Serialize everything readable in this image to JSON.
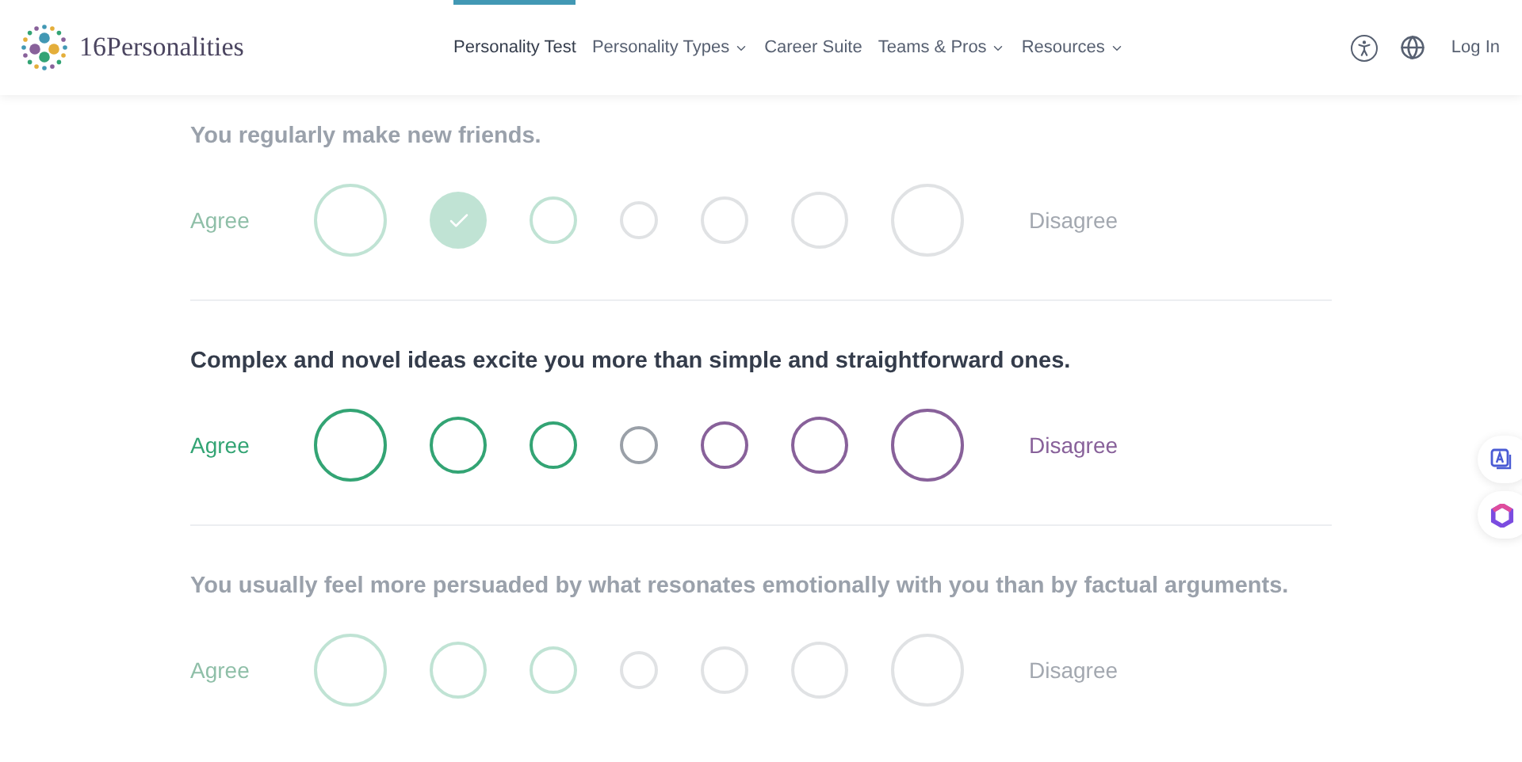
{
  "header": {
    "logo": "16Personalities",
    "nav": [
      {
        "label": "Personality Test",
        "selected": true,
        "has_menu": false
      },
      {
        "label": "Personality Types",
        "selected": false,
        "has_menu": true
      },
      {
        "label": "Career Suite",
        "selected": false,
        "has_menu": false
      },
      {
        "label": "Teams & Pros",
        "selected": false,
        "has_menu": true
      },
      {
        "label": "Resources",
        "selected": false,
        "has_menu": true
      }
    ],
    "login": "Log In"
  },
  "questions": [
    {
      "text": "You regularly make new friends.",
      "active": false,
      "agree": "Agree",
      "disagree": "Disagree",
      "options": [
        {
          "selected": false
        },
        {
          "selected": true
        },
        {
          "selected": false
        },
        {
          "selected": false
        },
        {
          "selected": false
        },
        {
          "selected": false
        },
        {
          "selected": false
        }
      ]
    },
    {
      "text": "Complex and novel ideas excite you more than simple and straightforward ones.",
      "active": true,
      "agree": "Agree",
      "disagree": "Disagree",
      "options": [
        {
          "selected": false
        },
        {
          "selected": false
        },
        {
          "selected": false
        },
        {
          "selected": false
        },
        {
          "selected": false
        },
        {
          "selected": false
        },
        {
          "selected": false
        }
      ]
    },
    {
      "text": "You usually feel more persuaded by what resonates emotionally with you than by factual arguments.",
      "active": false,
      "agree": "Agree",
      "disagree": "Disagree",
      "options": [
        {
          "selected": false
        },
        {
          "selected": false
        },
        {
          "selected": false
        },
        {
          "selected": false
        },
        {
          "selected": false
        },
        {
          "selected": false
        },
        {
          "selected": false
        }
      ]
    }
  ]
}
